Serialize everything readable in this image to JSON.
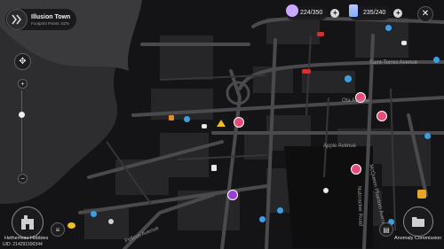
{
  "location": {
    "name": "Illusion Town",
    "subtitle": "Footprint Points: 52%"
  },
  "resources": [
    {
      "name": "battery",
      "value": "224/350"
    },
    {
      "name": "card",
      "value": "235/240"
    }
  ],
  "streets": [
    "Saint-Torres Avenue",
    "Ota Avenue",
    "Apple Avenue",
    "McQueen Phantom Avenue",
    "Nutcracker Road",
    "Fellcus Avenue"
  ],
  "bottom": {
    "left_button": "Hetherreau Hobbies",
    "right_button": "Anomaly Commission",
    "uid": "UID: 214291590344"
  },
  "colors": {
    "accent_pink": "#e84a7a",
    "accent_blue": "#3b9fe0",
    "accent_yellow": "#f0c020"
  }
}
